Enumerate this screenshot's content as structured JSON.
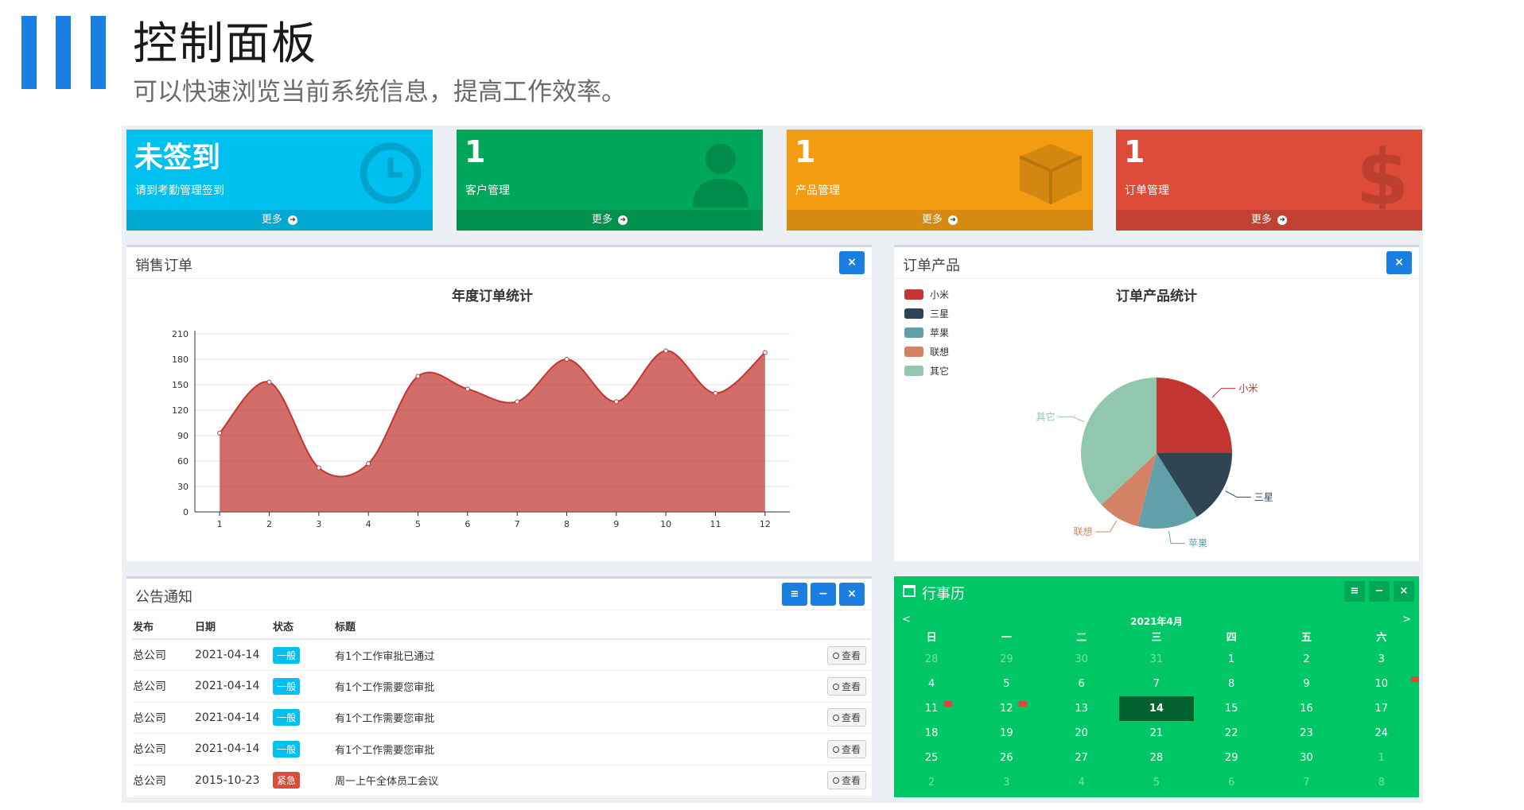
{
  "header": {
    "title": "控制面板",
    "subtitle": "可以快速浏览当前系统信息，提高工作效率。",
    "accent_color": "#1a7fe0"
  },
  "tiles": [
    {
      "value": "未签到",
      "label": "请到考勤管理签到",
      "more": "更多",
      "color": "#00c0ef",
      "icon": "clock-icon"
    },
    {
      "value": "1",
      "label": "客户管理",
      "more": "更多",
      "color": "#00a65a",
      "icon": "user-icon"
    },
    {
      "value": "1",
      "label": "产品管理",
      "more": "更多",
      "color": "#f39c12",
      "icon": "cube-icon"
    },
    {
      "value": "1",
      "label": "订单管理",
      "more": "更多",
      "color": "#dd4b39",
      "icon": "dollar-icon"
    }
  ],
  "sales_box": {
    "title": "销售订单",
    "close": "×"
  },
  "product_box": {
    "title": "订单产品",
    "close": "×"
  },
  "chart_data": [
    {
      "type": "area",
      "title": "年度订单统计",
      "x": [
        "1",
        "2",
        "3",
        "4",
        "5",
        "6",
        "7",
        "8",
        "9",
        "10",
        "11",
        "12"
      ],
      "values": [
        93,
        153,
        52,
        57,
        160,
        145,
        130,
        180,
        130,
        190,
        140,
        188
      ],
      "ylim": [
        0,
        210
      ],
      "yticks": [
        0,
        30,
        60,
        90,
        120,
        150,
        180,
        210
      ],
      "grid": true,
      "color": "#c23531"
    },
    {
      "type": "pie",
      "title": "订单产品统计",
      "legend_position": "top-left",
      "slices": [
        {
          "name": "小米",
          "value": 25,
          "color": "#c23531"
        },
        {
          "name": "三星",
          "value": 16,
          "color": "#2f4554"
        },
        {
          "name": "苹果",
          "value": 13,
          "color": "#61a0a8"
        },
        {
          "name": "联想",
          "value": 9,
          "color": "#d48265"
        },
        {
          "name": "其它",
          "value": 37,
          "color": "#91c7ae"
        }
      ]
    }
  ],
  "notice_box": {
    "title": "公告通知",
    "columns": [
      "发布",
      "日期",
      "状态",
      "标题"
    ],
    "view_label": "查看",
    "rows": [
      {
        "publisher": "总公司",
        "date": "2021-04-14",
        "status": "一般",
        "status_color": "#00c0ef",
        "title": "有1个工作审批已通过"
      },
      {
        "publisher": "总公司",
        "date": "2021-04-14",
        "status": "一般",
        "status_color": "#00c0ef",
        "title": "有1个工作需要您审批"
      },
      {
        "publisher": "总公司",
        "date": "2021-04-14",
        "status": "一般",
        "status_color": "#00c0ef",
        "title": "有1个工作需要您审批"
      },
      {
        "publisher": "总公司",
        "date": "2021-04-14",
        "status": "一般",
        "status_color": "#00c0ef",
        "title": "有1个工作需要您审批"
      },
      {
        "publisher": "总公司",
        "date": "2015-10-23",
        "status": "紧急",
        "status_color": "#dd4b39",
        "title": "周一上午全体员工会议"
      }
    ]
  },
  "calendar": {
    "title": "行事历",
    "month": "2021年4月",
    "prev": "<",
    "next": ">",
    "weekdays": [
      "日",
      "一",
      "二",
      "三",
      "四",
      "五",
      "六"
    ],
    "weeks": [
      [
        "28",
        "29",
        "30",
        "31",
        "1",
        "2",
        "3"
      ],
      [
        "4",
        "5",
        "6",
        "7",
        "8",
        "9",
        "10"
      ],
      [
        "11",
        "12",
        "13",
        "14",
        "15",
        "16",
        "17"
      ],
      [
        "18",
        "19",
        "20",
        "21",
        "22",
        "23",
        "24"
      ],
      [
        "25",
        "26",
        "27",
        "28",
        "29",
        "30",
        "1"
      ],
      [
        "2",
        "3",
        "4",
        "5",
        "6",
        "7",
        "8"
      ]
    ],
    "today": "14",
    "flag_days": [
      "10",
      "11",
      "12"
    ]
  }
}
